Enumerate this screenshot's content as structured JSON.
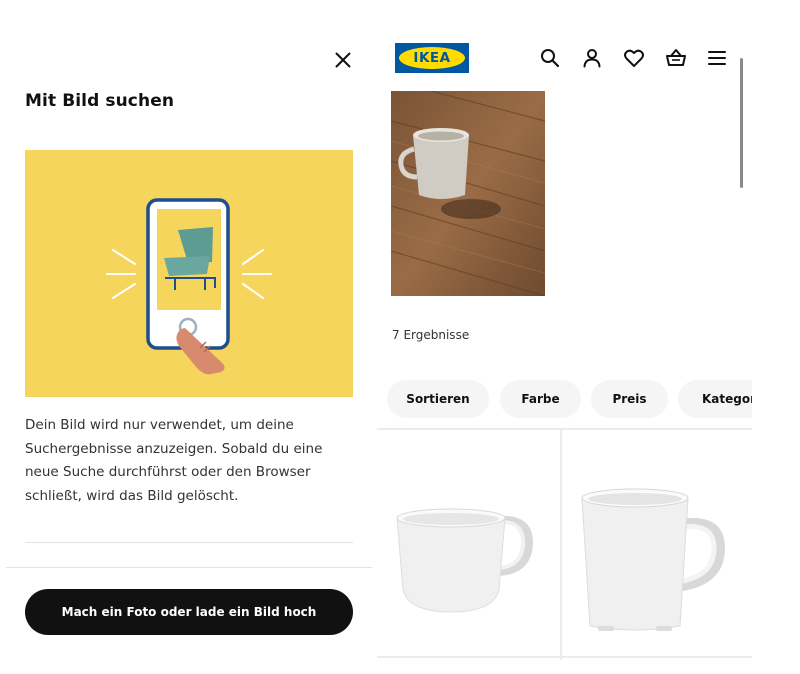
{
  "search_panel": {
    "title": "Mit Bild suchen",
    "close_icon": "close-icon",
    "illustration": "phone-camera-illustration",
    "info_text": "Dein Bild wird nur verwendet, um deine Suchergebnisse anzuzeigen. Sobald du eine neue Suche durchführst oder den Browser schließt, wird das Bild gelöscht.",
    "upload_button_label": "Mach ein Foto oder lade ein Bild hoch"
  },
  "header": {
    "logo_text": "IKEA",
    "icons": [
      "search-icon",
      "user-icon",
      "heart-icon",
      "basket-icon",
      "menu-icon"
    ]
  },
  "results": {
    "count_text": "7 Ergebnisse",
    "filters": [
      "Sortieren",
      "Farbe",
      "Preis",
      "Kategorie"
    ],
    "products": [
      "white-wide-mug",
      "white-tall-mug"
    ]
  },
  "colors": {
    "illustration_bg": "#f6d55c",
    "ikea_blue": "#0058a3",
    "ikea_yellow": "#ffdb00",
    "button_bg": "#111111",
    "chip_bg": "#f5f5f5"
  }
}
